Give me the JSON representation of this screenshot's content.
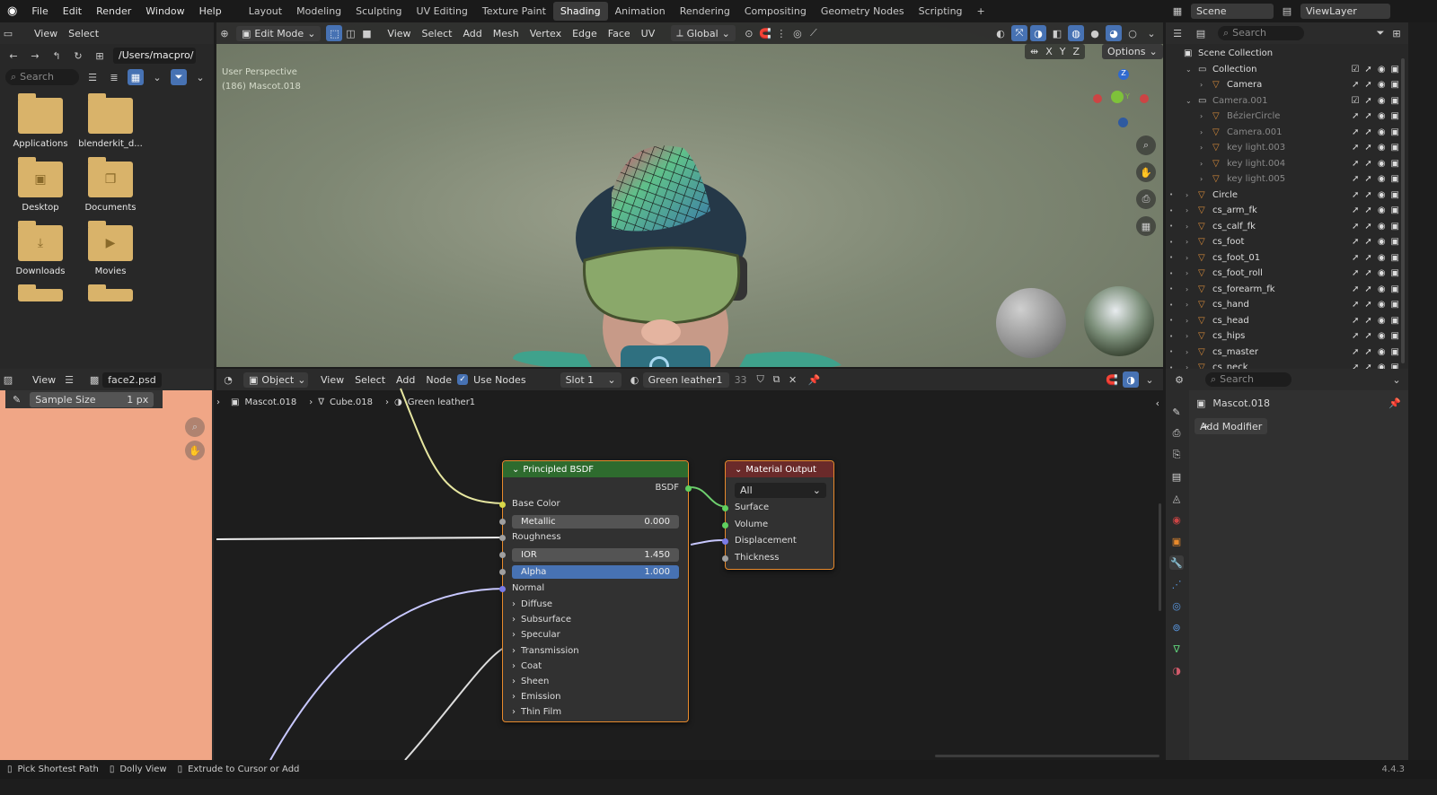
{
  "topbar": {
    "menus": [
      "File",
      "Edit",
      "Render",
      "Window",
      "Help"
    ],
    "workspaces": [
      "Layout",
      "Modeling",
      "Sculpting",
      "UV Editing",
      "Texture Paint",
      "Shading",
      "Animation",
      "Rendering",
      "Compositing",
      "Geometry Nodes",
      "Scripting"
    ],
    "active_workspace": "Shading",
    "add_tab": "+",
    "scene": "Scene",
    "view_layer": "ViewLayer"
  },
  "file_browser": {
    "menu": [
      "View",
      "Select"
    ],
    "path": "/Users/macpro/",
    "search_placeholder": "Search",
    "items": [
      {
        "label": "Applications"
      },
      {
        "label": "blenderkit_d..."
      },
      {
        "label": "Desktop"
      },
      {
        "label": "Documents"
      },
      {
        "label": "Downloads"
      },
      {
        "label": "Movies"
      }
    ]
  },
  "viewport": {
    "mode": "Edit Mode",
    "menus": [
      "View",
      "Select",
      "Add",
      "Mesh",
      "Vertex",
      "Edge",
      "Face",
      "UV"
    ],
    "orientation": "Global",
    "overlay_line1": "User Perspective",
    "overlay_line2": "(186) Mascot.018",
    "axes": [
      "X",
      "Y",
      "Z"
    ],
    "options": "Options",
    "gizmo_z": "Z",
    "gizmo_y": "Y"
  },
  "outliner": {
    "search_placeholder": "Search",
    "root": "Scene Collection",
    "rows": [
      {
        "name": "Collection",
        "level": 1
      },
      {
        "name": "Camera",
        "level": 2
      },
      {
        "name": "Camera.001",
        "level": 1,
        "dim": true
      },
      {
        "name": "BézierCircle",
        "level": 2,
        "dim": true
      },
      {
        "name": "Camera.001",
        "level": 2,
        "dim": true
      },
      {
        "name": "key light.003",
        "level": 2,
        "dim": true
      },
      {
        "name": "key light.004",
        "level": 2,
        "dim": true
      },
      {
        "name": "key light.005",
        "level": 2,
        "dim": true
      },
      {
        "name": "Circle",
        "level": 1
      },
      {
        "name": "cs_arm_fk",
        "level": 1
      },
      {
        "name": "cs_calf_fk",
        "level": 1
      },
      {
        "name": "cs_foot",
        "level": 1
      },
      {
        "name": "cs_foot_01",
        "level": 1
      },
      {
        "name": "cs_foot_roll",
        "level": 1
      },
      {
        "name": "cs_forearm_fk",
        "level": 1
      },
      {
        "name": "cs_hand",
        "level": 1
      },
      {
        "name": "cs_head",
        "level": 1
      },
      {
        "name": "cs_hips",
        "level": 1
      },
      {
        "name": "cs_master",
        "level": 1
      },
      {
        "name": "cs_neck",
        "level": 1
      }
    ]
  },
  "image_editor": {
    "menu": "View",
    "image_name": "face2.psd",
    "sample_label": "Sample Size",
    "sample_value": "1 px",
    "fill_color": "#f0a686"
  },
  "node_editor": {
    "object": "Object",
    "menus": [
      "View",
      "Select",
      "Add",
      "Node"
    ],
    "use_nodes": "Use Nodes",
    "slot": "Slot 1",
    "material": "Green leather1",
    "users": "33",
    "breadcrumb": [
      "Mascot.018",
      "Cube.018",
      "Green leather1"
    ],
    "bsdf": {
      "title": "Principled BSDF",
      "output": "BSDF",
      "inputs": [
        "Base Color",
        "Roughness",
        "Normal"
      ],
      "metallic_label": "Metallic",
      "metallic_value": "0.000",
      "ior_label": "IOR",
      "ior_value": "1.450",
      "alpha_label": "Alpha",
      "alpha_value": "1.000",
      "panels": [
        "Diffuse",
        "Subsurface",
        "Specular",
        "Transmission",
        "Coat",
        "Sheen",
        "Emission",
        "Thin Film"
      ]
    },
    "output_node": {
      "title": "Material Output",
      "target": "All",
      "inputs": [
        "Surface",
        "Volume",
        "Displacement",
        "Thickness"
      ]
    }
  },
  "properties": {
    "search_placeholder": "Search",
    "object": "Mascot.018",
    "add_modifier": "Add Modifier"
  },
  "statusbar": {
    "hints": [
      "Pick Shortest Path",
      "Dolly View",
      "Extrude to Cursor or Add"
    ],
    "version": "4.4.3"
  }
}
